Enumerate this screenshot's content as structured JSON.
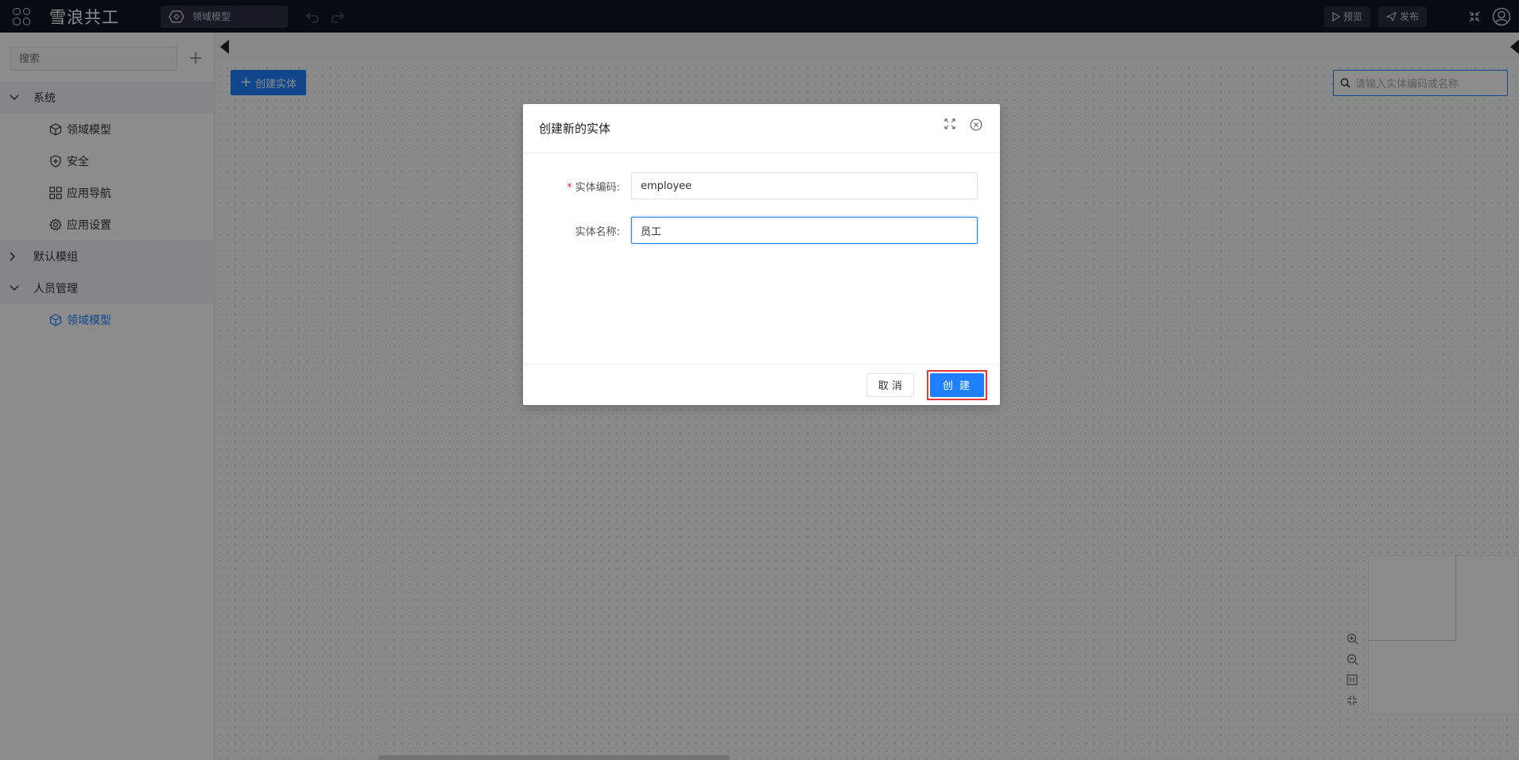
{
  "app": {
    "title": "雪浪共工",
    "module_select": "领域模型",
    "preview_label": "预览",
    "publish_label": "发布"
  },
  "sidebar": {
    "search_placeholder": "搜索",
    "groups": [
      {
        "label": "系统",
        "expanded": true,
        "items": [
          {
            "label": "领域模型",
            "icon": "cube-icon"
          },
          {
            "label": "安全",
            "icon": "shield-icon"
          },
          {
            "label": "应用导航",
            "icon": "grid-icon"
          },
          {
            "label": "应用设置",
            "icon": "gear-icon"
          }
        ]
      },
      {
        "label": "默认模组",
        "expanded": false,
        "items": []
      },
      {
        "label": "人员管理",
        "expanded": true,
        "items": [
          {
            "label": "领域模型",
            "icon": "cube-icon",
            "active": true
          }
        ]
      }
    ]
  },
  "canvas": {
    "create_entity_label": "创建实体",
    "entity_search_placeholder": "请输入实体编码或名称"
  },
  "modal": {
    "title": "创建新的实体",
    "fields": [
      {
        "label": "实体编码:",
        "required": true,
        "value": "employee"
      },
      {
        "label": "实体名称:",
        "required": false,
        "value": "员工"
      }
    ],
    "cancel_label": "取 消",
    "create_label": "创 建"
  },
  "colors": {
    "accent": "#1e80ff",
    "topbar": "#0d1526",
    "highlight": "#e53935",
    "required": "#f5222d"
  }
}
